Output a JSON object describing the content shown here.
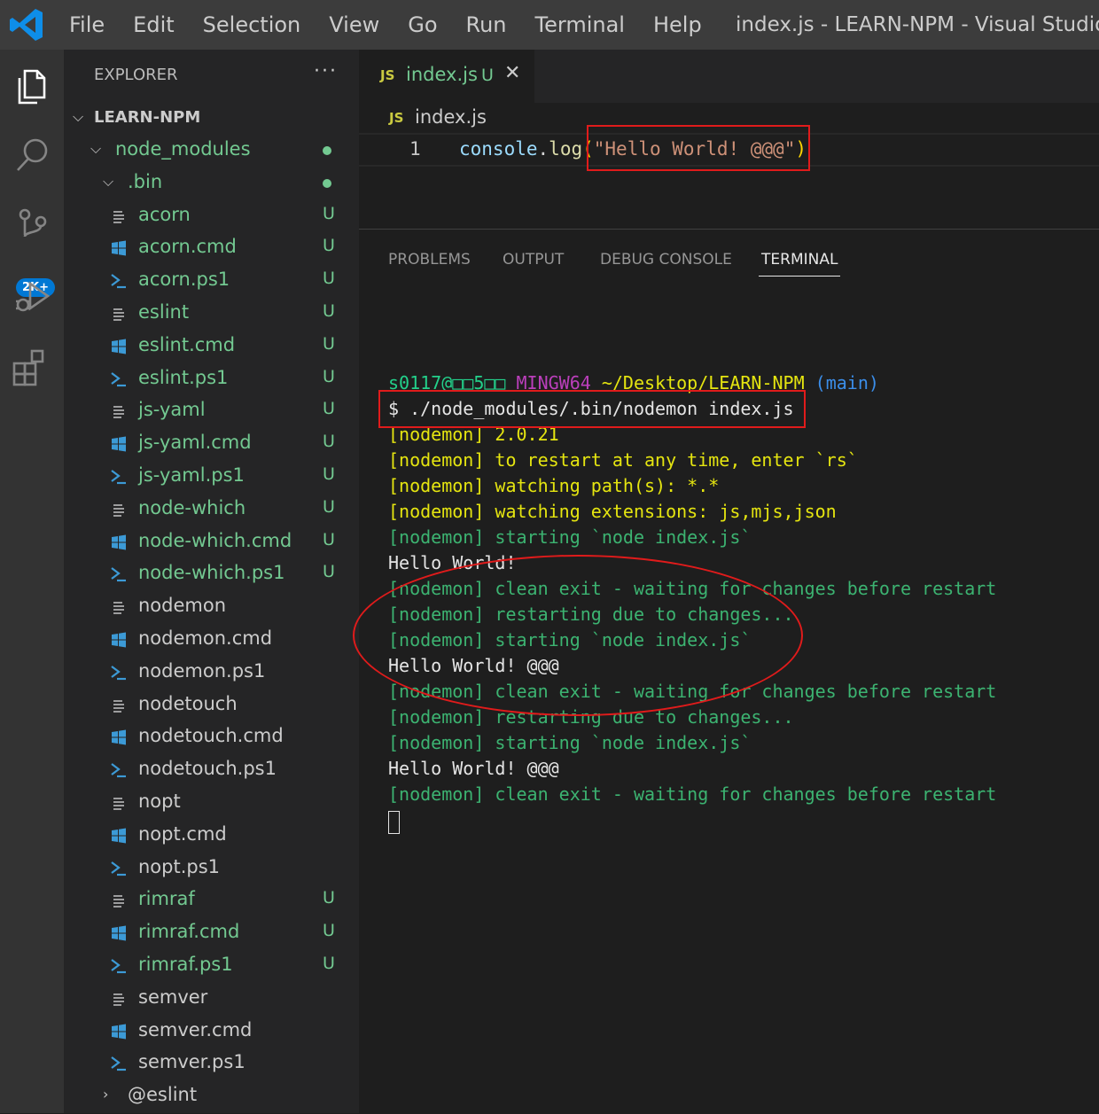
{
  "window": {
    "menu": [
      "File",
      "Edit",
      "Selection",
      "View",
      "Go",
      "Run",
      "Terminal",
      "Help"
    ],
    "title": "index.js - LEARN-NPM - Visual Studio C"
  },
  "activity": {
    "source_control_badge": "2K+"
  },
  "explorer": {
    "title": "EXPLORER",
    "more": "···",
    "root": "LEARN-NPM",
    "items": [
      {
        "label": "node_modules",
        "kind": "folder",
        "status": "dot"
      },
      {
        "label": ".bin",
        "kind": "folder",
        "status": "dot"
      },
      {
        "label": "acorn",
        "kind": "file",
        "status": "U"
      },
      {
        "label": "acorn.cmd",
        "kind": "cmd",
        "status": "U"
      },
      {
        "label": "acorn.ps1",
        "kind": "ps1",
        "status": "U"
      },
      {
        "label": "eslint",
        "kind": "file",
        "status": "U"
      },
      {
        "label": "eslint.cmd",
        "kind": "cmd",
        "status": "U"
      },
      {
        "label": "eslint.ps1",
        "kind": "ps1",
        "status": "U"
      },
      {
        "label": "js-yaml",
        "kind": "file",
        "status": "U"
      },
      {
        "label": "js-yaml.cmd",
        "kind": "cmd",
        "status": "U"
      },
      {
        "label": "js-yaml.ps1",
        "kind": "ps1",
        "status": "U"
      },
      {
        "label": "node-which",
        "kind": "file",
        "status": "U"
      },
      {
        "label": "node-which.cmd",
        "kind": "cmd",
        "status": "U"
      },
      {
        "label": "node-which.ps1",
        "kind": "ps1",
        "status": "U"
      },
      {
        "label": "nodemon",
        "kind": "file",
        "status": ""
      },
      {
        "label": "nodemon.cmd",
        "kind": "cmd",
        "status": ""
      },
      {
        "label": "nodemon.ps1",
        "kind": "ps1",
        "status": ""
      },
      {
        "label": "nodetouch",
        "kind": "file",
        "status": ""
      },
      {
        "label": "nodetouch.cmd",
        "kind": "cmd",
        "status": ""
      },
      {
        "label": "nodetouch.ps1",
        "kind": "ps1",
        "status": ""
      },
      {
        "label": "nopt",
        "kind": "file",
        "status": ""
      },
      {
        "label": "nopt.cmd",
        "kind": "cmd",
        "status": ""
      },
      {
        "label": "nopt.ps1",
        "kind": "ps1",
        "status": ""
      },
      {
        "label": "rimraf",
        "kind": "file",
        "status": "U"
      },
      {
        "label": "rimraf.cmd",
        "kind": "cmd",
        "status": "U"
      },
      {
        "label": "rimraf.ps1",
        "kind": "ps1",
        "status": "U"
      },
      {
        "label": "semver",
        "kind": "file",
        "status": ""
      },
      {
        "label": "semver.cmd",
        "kind": "cmd",
        "status": ""
      },
      {
        "label": "semver.ps1",
        "kind": "ps1",
        "status": ""
      },
      {
        "label": "@eslint",
        "kind": "collapsed-folder",
        "status": ""
      }
    ]
  },
  "editor": {
    "tab": {
      "icon": "JS",
      "name": "index.js",
      "status": "U",
      "close": "✕"
    },
    "breadcrumb": {
      "icon": "JS",
      "name": "index.js"
    },
    "line_number": "1",
    "code": {
      "object": "console",
      "dot": ".",
      "function": "log",
      "open_paren": "(",
      "string": "\"Hello World! @@@\"",
      "close_paren": ")"
    }
  },
  "panel": {
    "tabs": [
      "PROBLEMS",
      "OUTPUT",
      "DEBUG CONSOLE",
      "TERMINAL"
    ],
    "active_tab": "TERMINAL",
    "prompt": {
      "user": "s0117@□□5□□",
      "shell": "MINGW64",
      "path": "~/Desktop/LEARN-NPM",
      "branch": "(main)"
    },
    "lines": [
      {
        "text": "$ ./node_modules/.bin/nodemon index.js",
        "color": "white"
      },
      {
        "text": "[nodemon] 2.0.21",
        "color": "yellow"
      },
      {
        "text": "[nodemon] to restart at any time, enter `rs`",
        "color": "yellow"
      },
      {
        "text": "[nodemon] watching path(s): *.*",
        "color": "yellow"
      },
      {
        "text": "[nodemon] watching extensions: js,mjs,json",
        "color": "yellow"
      },
      {
        "text": "[nodemon] starting `node index.js`",
        "color": "green"
      },
      {
        "text": "Hello World!",
        "color": "white"
      },
      {
        "text": "[nodemon] clean exit - waiting for changes before restart",
        "color": "green"
      },
      {
        "text": "[nodemon] restarting due to changes...",
        "color": "green"
      },
      {
        "text": "[nodemon] starting `node index.js`",
        "color": "green"
      },
      {
        "text": "Hello World! @@@",
        "color": "white"
      },
      {
        "text": "[nodemon] clean exit - waiting for changes before restart",
        "color": "green"
      },
      {
        "text": "[nodemon] restarting due to changes...",
        "color": "green"
      },
      {
        "text": "[nodemon] starting `node index.js`",
        "color": "green"
      },
      {
        "text": "Hello World! @@@",
        "color": "white"
      },
      {
        "text": "[nodemon] clean exit - waiting for changes before restart",
        "color": "green"
      }
    ]
  },
  "colors": {
    "annotation_red": "#e01b1b",
    "git_untracked": "#73c991",
    "accent": "#0078d4"
  }
}
